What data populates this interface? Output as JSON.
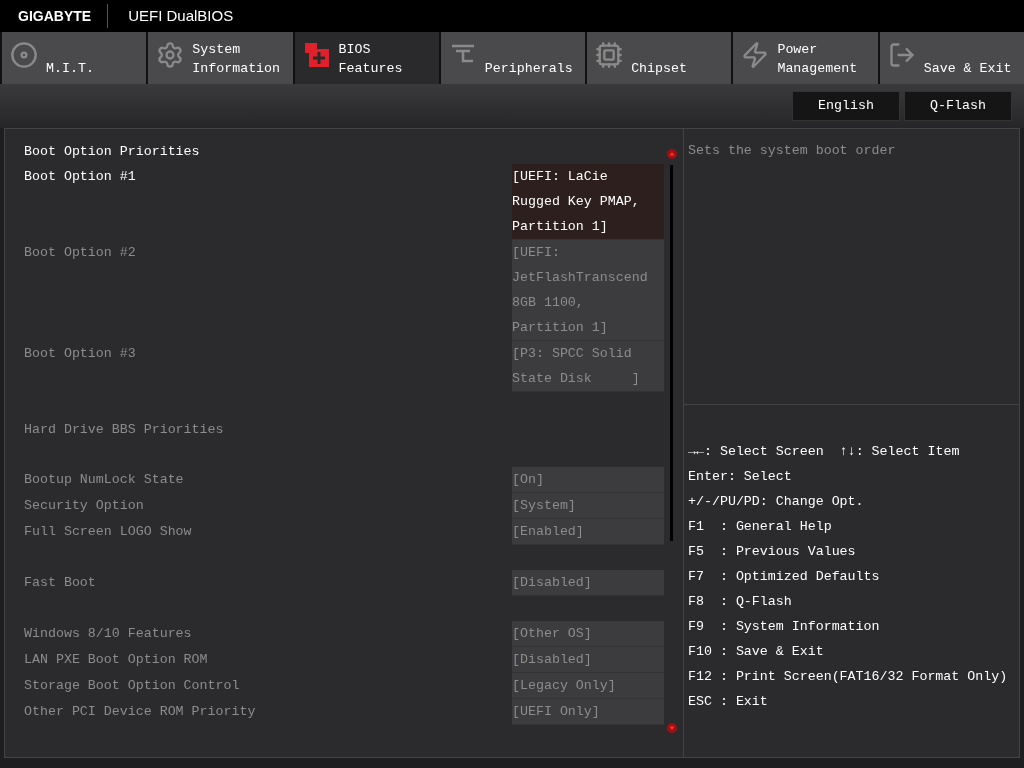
{
  "brand": {
    "logo": "GIGABYTE",
    "title": "UEFI DualBIOS"
  },
  "tabs": [
    {
      "label": "M.I.T.",
      "kind": "disc",
      "selected": false
    },
    {
      "label": "System\nInformation",
      "kind": "gear",
      "selected": false
    },
    {
      "label": "BIOS\nFeatures",
      "kind": "bios",
      "selected": true
    },
    {
      "label": "Peripherals",
      "kind": "plug",
      "selected": false
    },
    {
      "label": "Chipset",
      "kind": "chip",
      "selected": false
    },
    {
      "label": "Power\nManagement",
      "kind": "power",
      "selected": false
    },
    {
      "label": "Save & Exit",
      "kind": "exit",
      "selected": false
    }
  ],
  "buttons": [
    "English",
    "Q-Flash"
  ],
  "groups": [
    [
      {
        "kind": "header",
        "label": "Boot Option Priorities"
      },
      {
        "kind": "setting",
        "label": "Boot Option #1",
        "value": "[UEFI: LaCie\nRugged Key PMAP,\nPartition 1]",
        "selected": true
      },
      {
        "kind": "setting",
        "label": "Boot Option #2",
        "value": "[UEFI:\nJetFlashTranscend\n8GB 1100,\nPartition 1]",
        "selected": false
      },
      {
        "kind": "setting",
        "label": "Boot Option #3",
        "value": "[P3: SPCC Solid\nState Disk     ]",
        "selected": false
      }
    ],
    [
      {
        "kind": "setting",
        "label": "Hard Drive BBS Priorities",
        "selected": false
      }
    ],
    [
      {
        "kind": "setting",
        "label": "Bootup NumLock State",
        "value": "[On]",
        "selected": false
      },
      {
        "kind": "setting",
        "label": "Security Option",
        "value": "[System]",
        "selected": false
      },
      {
        "kind": "setting",
        "label": "Full Screen LOGO Show",
        "value": "[Enabled]",
        "selected": false
      }
    ],
    [
      {
        "kind": "setting",
        "label": "Fast Boot",
        "value": "[Disabled]",
        "selected": false
      }
    ],
    [
      {
        "kind": "setting",
        "label": "Windows 8/10 Features",
        "value": "[Other OS]",
        "selected": false
      },
      {
        "kind": "setting",
        "label": "LAN PXE Boot Option ROM",
        "value": "[Disabled]",
        "selected": false
      },
      {
        "kind": "setting",
        "label": "Storage Boot Option Control",
        "value": "[Legacy Only]",
        "selected": false
      },
      {
        "kind": "setting",
        "label": "Other PCI Device ROM Priority",
        "value": "[UEFI Only]",
        "selected": false
      }
    ]
  ],
  "help": "Sets the system boot order",
  "keys": [
    {
      "kind": "nav",
      "items": [
        {
          "keys": "→←",
          "action": ": Select Screen"
        },
        {
          "keys": "↑↓",
          "action": ": Select Item"
        }
      ]
    },
    {
      "kind": "line",
      "text": "Enter: Select"
    },
    {
      "kind": "line",
      "text": "+/-/PU/PD: Change Opt."
    },
    {
      "kind": "line",
      "text": "F1  : General Help"
    },
    {
      "kind": "line",
      "text": "F5  : Previous Values"
    },
    {
      "kind": "line",
      "text": "F7  : Optimized Defaults"
    },
    {
      "kind": "line",
      "text": "F8  : Q-Flash"
    },
    {
      "kind": "line",
      "text": "F9  : System Information"
    },
    {
      "kind": "line",
      "text": "F10 : Save & Exit"
    },
    {
      "kind": "line",
      "text": "F12 : Print Screen(FAT16/32 Format Only)"
    },
    {
      "kind": "line",
      "text": "ESC : Exit"
    }
  ]
}
